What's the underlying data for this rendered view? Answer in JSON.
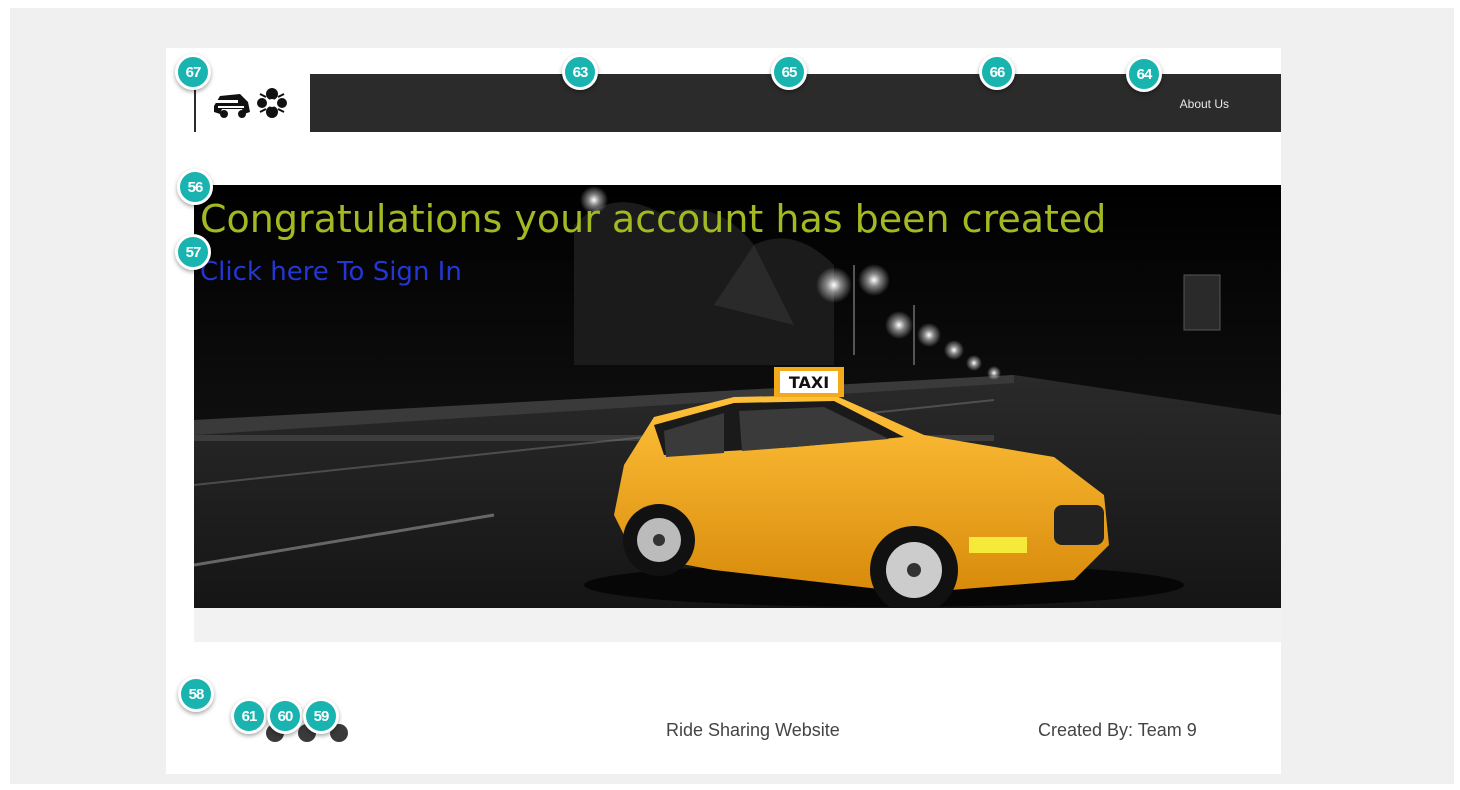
{
  "nav": {
    "about_label": "About Us",
    "logo_icon": "car-rideshare-logo-icon"
  },
  "hero": {
    "title": "Congratulations your account has been created",
    "signin_link": "Click here To Sign In",
    "taxi_sign": "TAXI",
    "title_color": "#a3b822",
    "link_color": "#2336d6"
  },
  "footer": {
    "site_name": "Ride Sharing Website",
    "credit": "Created By: Team 9",
    "social_icons": [
      "social-icon-1",
      "social-icon-2",
      "social-icon-3"
    ]
  },
  "markers": {
    "m67": "67",
    "m63": "63",
    "m65": "65",
    "m66": "66",
    "m64": "64",
    "m56": "56",
    "m57": "57",
    "m58": "58",
    "m61": "61",
    "m60": "60",
    "m59": "59"
  },
  "colors": {
    "navbar": "#2b2b2b",
    "marker": "#19b3b0",
    "taxi_yellow": "#f2a91a"
  }
}
